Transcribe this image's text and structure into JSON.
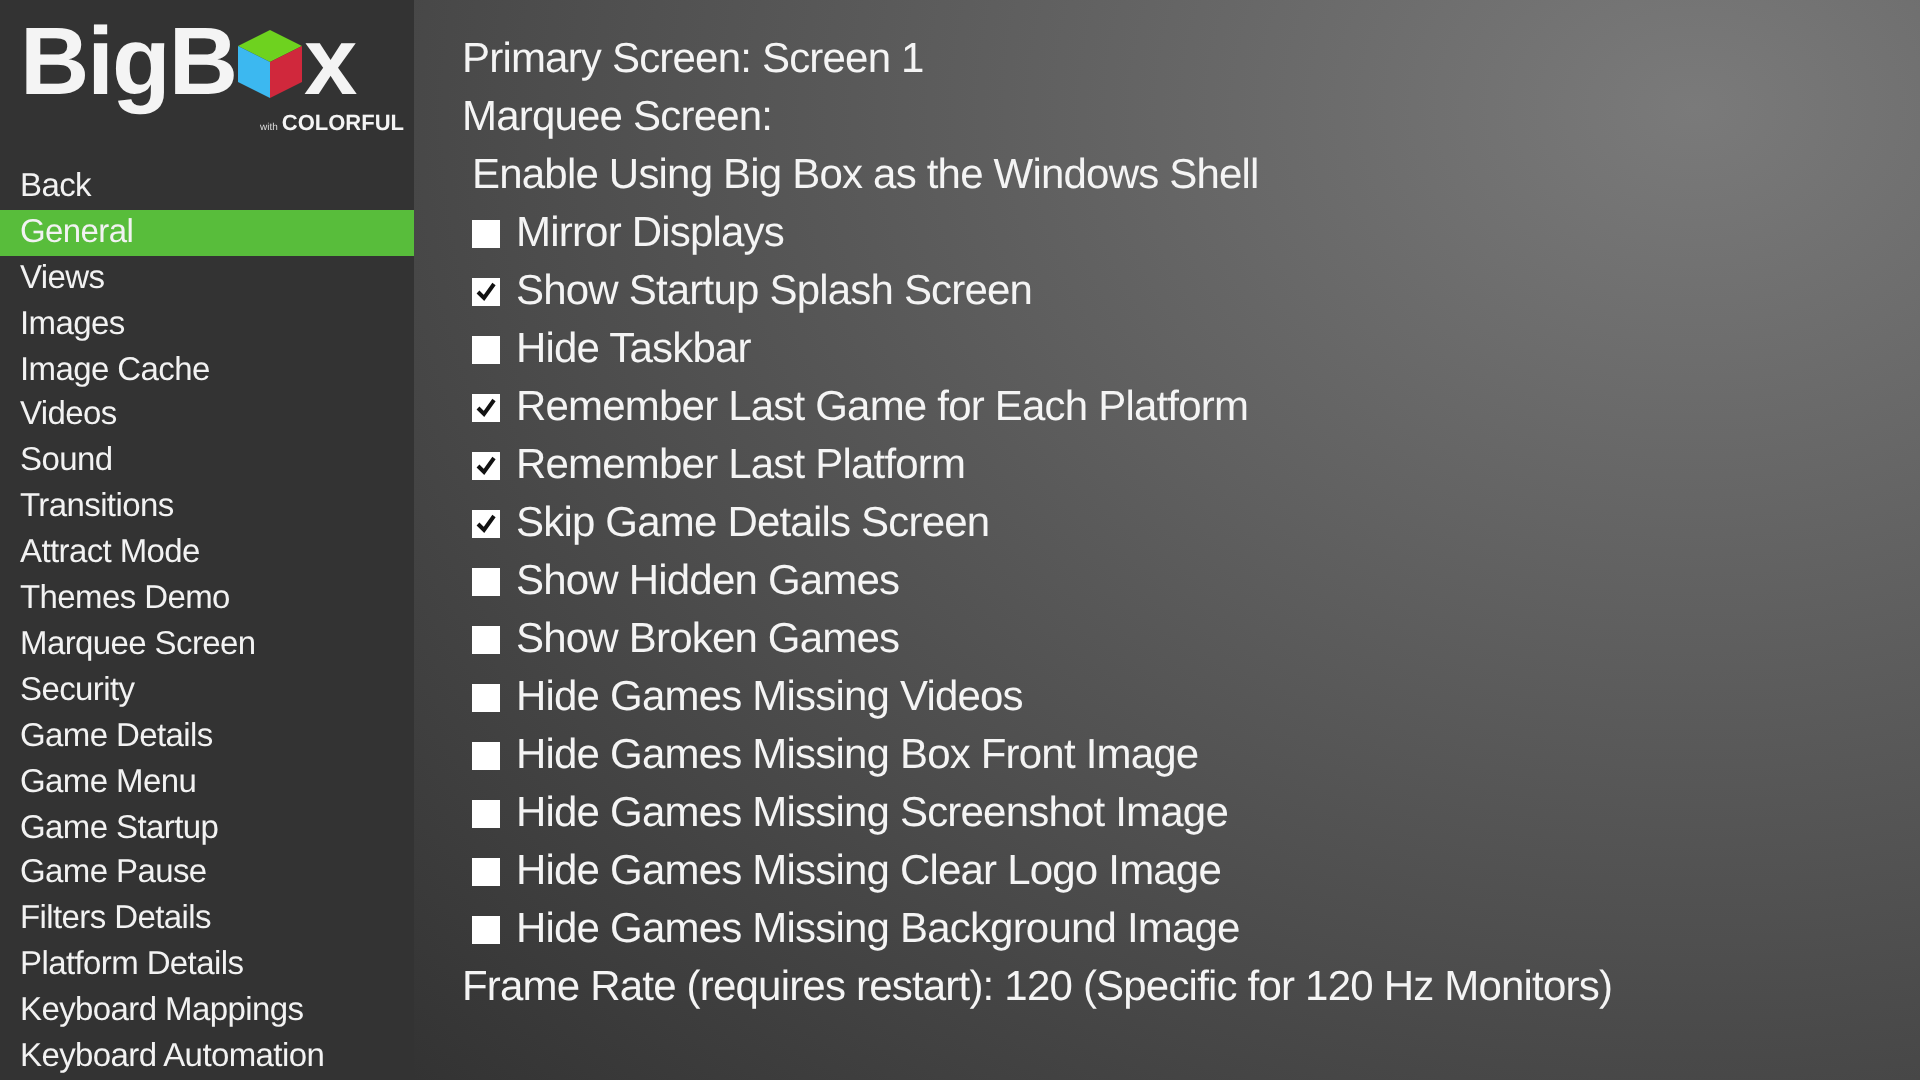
{
  "logo": {
    "text_before": "BigB",
    "text_after": "x",
    "tagline_prefix": "with",
    "tagline": "COLORFUL"
  },
  "sidebar": {
    "items": [
      {
        "label": "Back",
        "selected": false
      },
      {
        "label": "General",
        "selected": true
      },
      {
        "label": "Views",
        "selected": false
      },
      {
        "label": "Images",
        "selected": false
      },
      {
        "label": "Image Cache",
        "selected": false
      },
      {
        "label": "Videos",
        "selected": false
      },
      {
        "label": "Sound",
        "selected": false
      },
      {
        "label": "Transitions",
        "selected": false
      },
      {
        "label": "Attract Mode",
        "selected": false
      },
      {
        "label": "Themes Demo",
        "selected": false
      },
      {
        "label": "Marquee Screen",
        "selected": false
      },
      {
        "label": "Security",
        "selected": false
      },
      {
        "label": "Game Details",
        "selected": false
      },
      {
        "label": "Game Menu",
        "selected": false
      },
      {
        "label": "Game Startup",
        "selected": false
      },
      {
        "label": "Game Pause",
        "selected": false
      },
      {
        "label": "Filters Details",
        "selected": false
      },
      {
        "label": "Platform Details",
        "selected": false
      },
      {
        "label": "Keyboard Mappings",
        "selected": false
      },
      {
        "label": "Keyboard Automation",
        "selected": false
      }
    ]
  },
  "settings": [
    {
      "kind": "value",
      "label": "Primary Screen: Screen 1"
    },
    {
      "kind": "value",
      "label": "Marquee Screen:"
    },
    {
      "kind": "action",
      "label": "Enable Using Big Box as the Windows Shell"
    },
    {
      "kind": "checkbox",
      "label": "Mirror Displays",
      "checked": false
    },
    {
      "kind": "checkbox",
      "label": "Show Startup Splash Screen",
      "checked": true
    },
    {
      "kind": "checkbox",
      "label": "Hide Taskbar",
      "checked": false
    },
    {
      "kind": "checkbox",
      "label": "Remember Last Game for Each Platform",
      "checked": true
    },
    {
      "kind": "checkbox",
      "label": "Remember Last Platform",
      "checked": true
    },
    {
      "kind": "checkbox",
      "label": "Skip Game Details Screen",
      "checked": true
    },
    {
      "kind": "checkbox",
      "label": "Show Hidden Games",
      "checked": false
    },
    {
      "kind": "checkbox",
      "label": "Show Broken Games",
      "checked": false
    },
    {
      "kind": "checkbox",
      "label": "Hide Games Missing Videos",
      "checked": false
    },
    {
      "kind": "checkbox",
      "label": "Hide Games Missing Box Front Image",
      "checked": false
    },
    {
      "kind": "checkbox",
      "label": "Hide Games Missing Screenshot Image",
      "checked": false
    },
    {
      "kind": "checkbox",
      "label": "Hide Games Missing Clear Logo Image",
      "checked": false
    },
    {
      "kind": "checkbox",
      "label": "Hide Games Missing Background Image",
      "checked": false
    },
    {
      "kind": "value",
      "label": "Frame Rate (requires restart): 120 (Specific for 120 Hz Monitors)"
    }
  ]
}
